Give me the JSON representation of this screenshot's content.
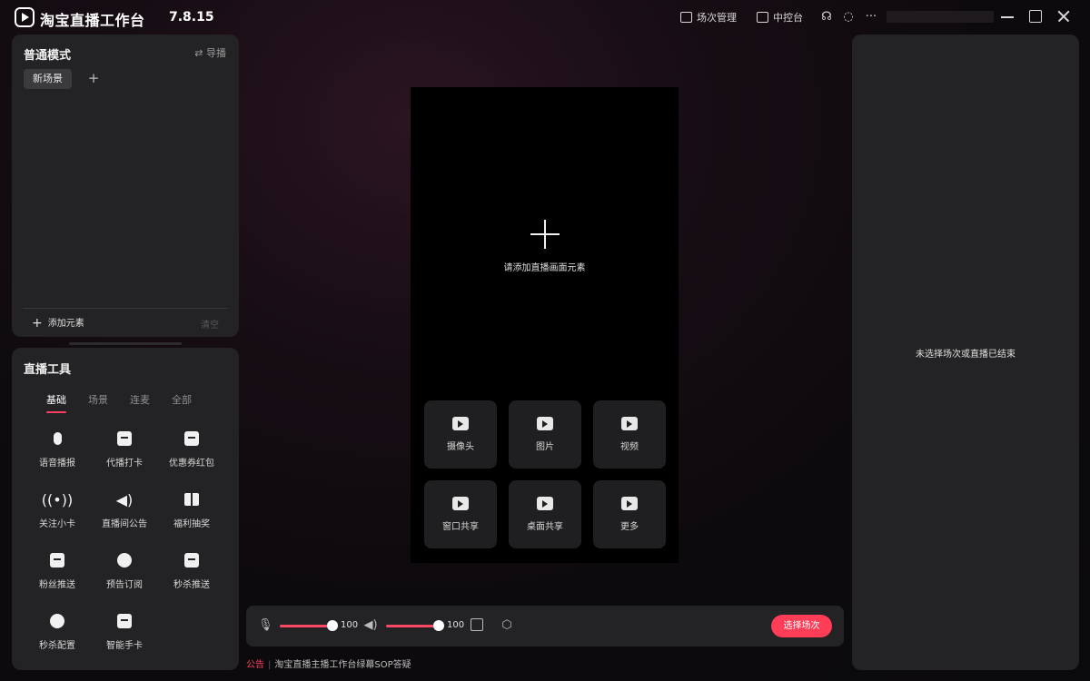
{
  "app": {
    "title": "淘宝直播工作台",
    "version": "7.8.15"
  },
  "titlebar": {
    "session_manage": "场次管理",
    "control_center": "中控台"
  },
  "scene_panel": {
    "title": "普通模式",
    "switch_label": "⇄ 导播",
    "scene_tab": "新场景",
    "add_scene": "+",
    "add_element": "添加元素",
    "clear": "清空"
  },
  "tools_panel": {
    "title": "直播工具",
    "tabs": [
      "基础",
      "场景",
      "连麦",
      "全部"
    ],
    "items": [
      {
        "label": "语音播报",
        "icon": "microphone-icon"
      },
      {
        "label": "代播打卡",
        "icon": "clipboard-check-icon"
      },
      {
        "label": "优惠券红包",
        "icon": "red-packet-icon"
      },
      {
        "label": "关注小卡",
        "icon": "broadcast-icon"
      },
      {
        "label": "直播间公告",
        "icon": "speaker-icon"
      },
      {
        "label": "福利抽奖",
        "icon": "gift-icon"
      },
      {
        "label": "粉丝推送",
        "icon": "push-icon"
      },
      {
        "label": "预告订阅",
        "icon": "subscribe-icon"
      },
      {
        "label": "秒杀推送",
        "icon": "flash-sale-icon"
      },
      {
        "label": "秒杀配置",
        "icon": "flash-config-icon"
      },
      {
        "label": "智能手卡",
        "icon": "smart-card-icon"
      }
    ]
  },
  "preview": {
    "hint": "请添加直播画面元素",
    "sources": [
      {
        "label": "摄像头",
        "icon": "camera-icon"
      },
      {
        "label": "图片",
        "icon": "image-icon"
      },
      {
        "label": "视频",
        "icon": "video-icon"
      },
      {
        "label": "窗口共享",
        "icon": "window-share-icon"
      },
      {
        "label": "桌面共享",
        "icon": "desktop-share-icon"
      },
      {
        "label": "更多",
        "icon": "folder-icon"
      }
    ]
  },
  "controls": {
    "mic_volume": "100",
    "speaker_volume": "100",
    "select_session": "选择场次"
  },
  "announcement": {
    "tag": "公告",
    "text": "淘宝直播主播工作台绿幕SOP答疑"
  },
  "right_panel": {
    "message": "未选择场次或直播已结束"
  },
  "colors": {
    "accent": "#ff3f62",
    "panel": "#232224",
    "preview_bg": "#000000"
  }
}
